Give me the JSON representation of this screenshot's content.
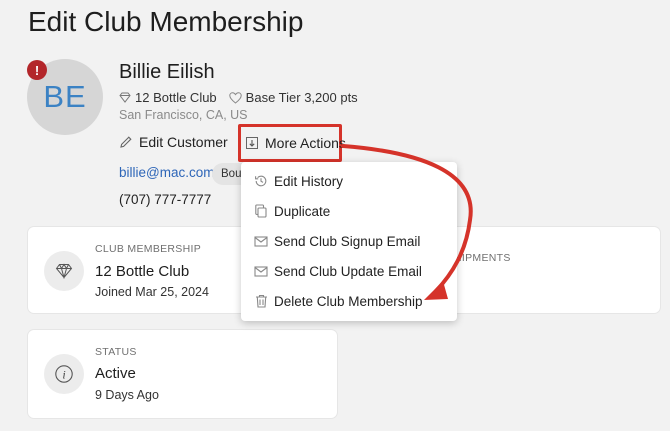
{
  "page": {
    "title": "Edit Club Membership"
  },
  "customer": {
    "initials": "BE",
    "alert_glyph": "!",
    "name": "Billie Eilish",
    "club": "12 Bottle Club",
    "tier": "Base Tier 3,200 pts",
    "location": "San Francisco, CA, US",
    "email": "billie@mac.com",
    "tag": "Bou",
    "phone": "(707) 777-7777"
  },
  "actions": {
    "edit_customer": "Edit Customer",
    "more_actions": "More Actions"
  },
  "menu": {
    "items": [
      {
        "label": "Edit History",
        "icon": "history-icon"
      },
      {
        "label": "Duplicate",
        "icon": "copy-icon"
      },
      {
        "label": "Send Club Signup Email",
        "icon": "envelope-icon"
      },
      {
        "label": "Send Club Update Email",
        "icon": "envelope-icon"
      },
      {
        "label": "Delete Club Membership",
        "icon": "trash-icon"
      }
    ]
  },
  "cards": {
    "club": {
      "label": "CLUB MEMBERSHIP",
      "value": "12 Bottle Club",
      "sub": "Joined Mar 25, 2024",
      "shipments_label": "HIPMENTS"
    },
    "status": {
      "label": "STATUS",
      "value": "Active",
      "sub": "9 Days Ago"
    }
  },
  "colors": {
    "accent_red": "#d5332a",
    "link_blue": "#2e66b8",
    "avatar_text": "#3b82c4",
    "badge_red": "#b3262a"
  }
}
